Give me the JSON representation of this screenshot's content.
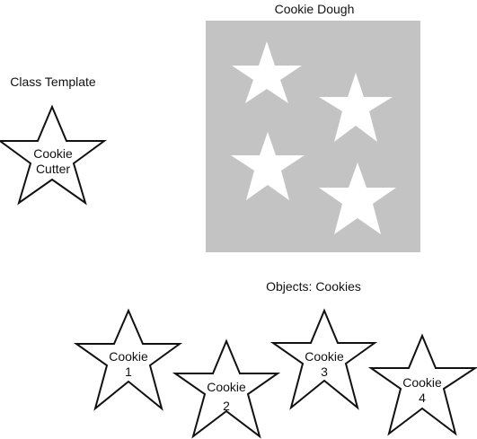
{
  "dough_title": "Cookie Dough",
  "template_title": "Class Template",
  "objects_title": "Objects: Cookies",
  "template_star": {
    "line1": "Cookie",
    "line2": "Cutter"
  },
  "cookies": [
    {
      "line1": "Cookie",
      "line2": "1"
    },
    {
      "line1": "Cookie",
      "line2": "2"
    },
    {
      "line1": "Cookie",
      "line2": "3"
    },
    {
      "line1": "Cookie",
      "line2": "4"
    }
  ],
  "colors": {
    "dough": "#c3c3c3",
    "cutout": "#ffffff",
    "outline": "#111111"
  }
}
